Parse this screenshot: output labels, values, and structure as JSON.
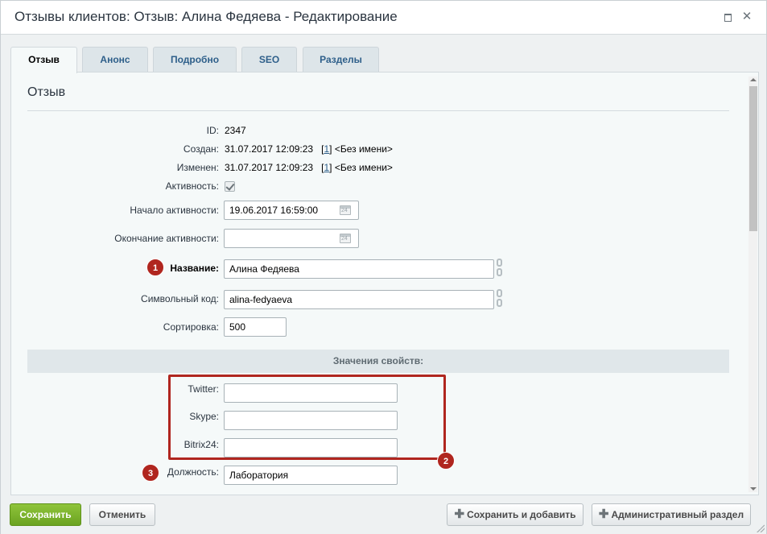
{
  "window": {
    "title": "Отзывы клиентов: Отзыв: Алина Федяева - Редактирование"
  },
  "tabs": [
    {
      "label": "Отзыв",
      "active": true
    },
    {
      "label": "Анонс",
      "active": false
    },
    {
      "label": "Подробно",
      "active": false
    },
    {
      "label": "SEO",
      "active": false
    },
    {
      "label": "Разделы",
      "active": false
    }
  ],
  "section": {
    "title": "Отзыв"
  },
  "fields": {
    "id": {
      "label": "ID:",
      "value": "2347"
    },
    "created": {
      "label": "Создан:",
      "date": "31.07.2017 12:09:23",
      "link": "1",
      "user": "<Без имени>"
    },
    "modified": {
      "label": "Изменен:",
      "date": "31.07.2017 12:09:23",
      "link": "1",
      "user": "<Без имени>"
    },
    "active": {
      "label": "Активность:",
      "checked": true
    },
    "active_from": {
      "label": "Начало активности:",
      "value": "19.06.2017 16:59:00"
    },
    "active_to": {
      "label": "Окончание активности:",
      "value": ""
    },
    "name": {
      "label": "Название:",
      "value": "Алина Федяева"
    },
    "code": {
      "label": "Символьный код:",
      "value": "alina-fedyaeva"
    },
    "sort": {
      "label": "Сортировка:",
      "value": "500"
    }
  },
  "properties": {
    "header": "Значения свойств:",
    "twitter": {
      "label": "Twitter:",
      "value": ""
    },
    "skype": {
      "label": "Skype:",
      "value": ""
    },
    "bitrix24": {
      "label": "Bitrix24:",
      "value": ""
    },
    "position": {
      "label": "Должность:",
      "value": "Лаборатория"
    }
  },
  "markers": {
    "m1": "1",
    "m2": "2",
    "m3": "3"
  },
  "footer": {
    "save": "Сохранить",
    "cancel": "Отменить",
    "save_add": "Сохранить и добавить",
    "admin": "Административный раздел"
  },
  "colors": {
    "accent_green": "#7ab52c",
    "marker_red": "#b0261f",
    "link_blue": "#2e5f8a"
  }
}
